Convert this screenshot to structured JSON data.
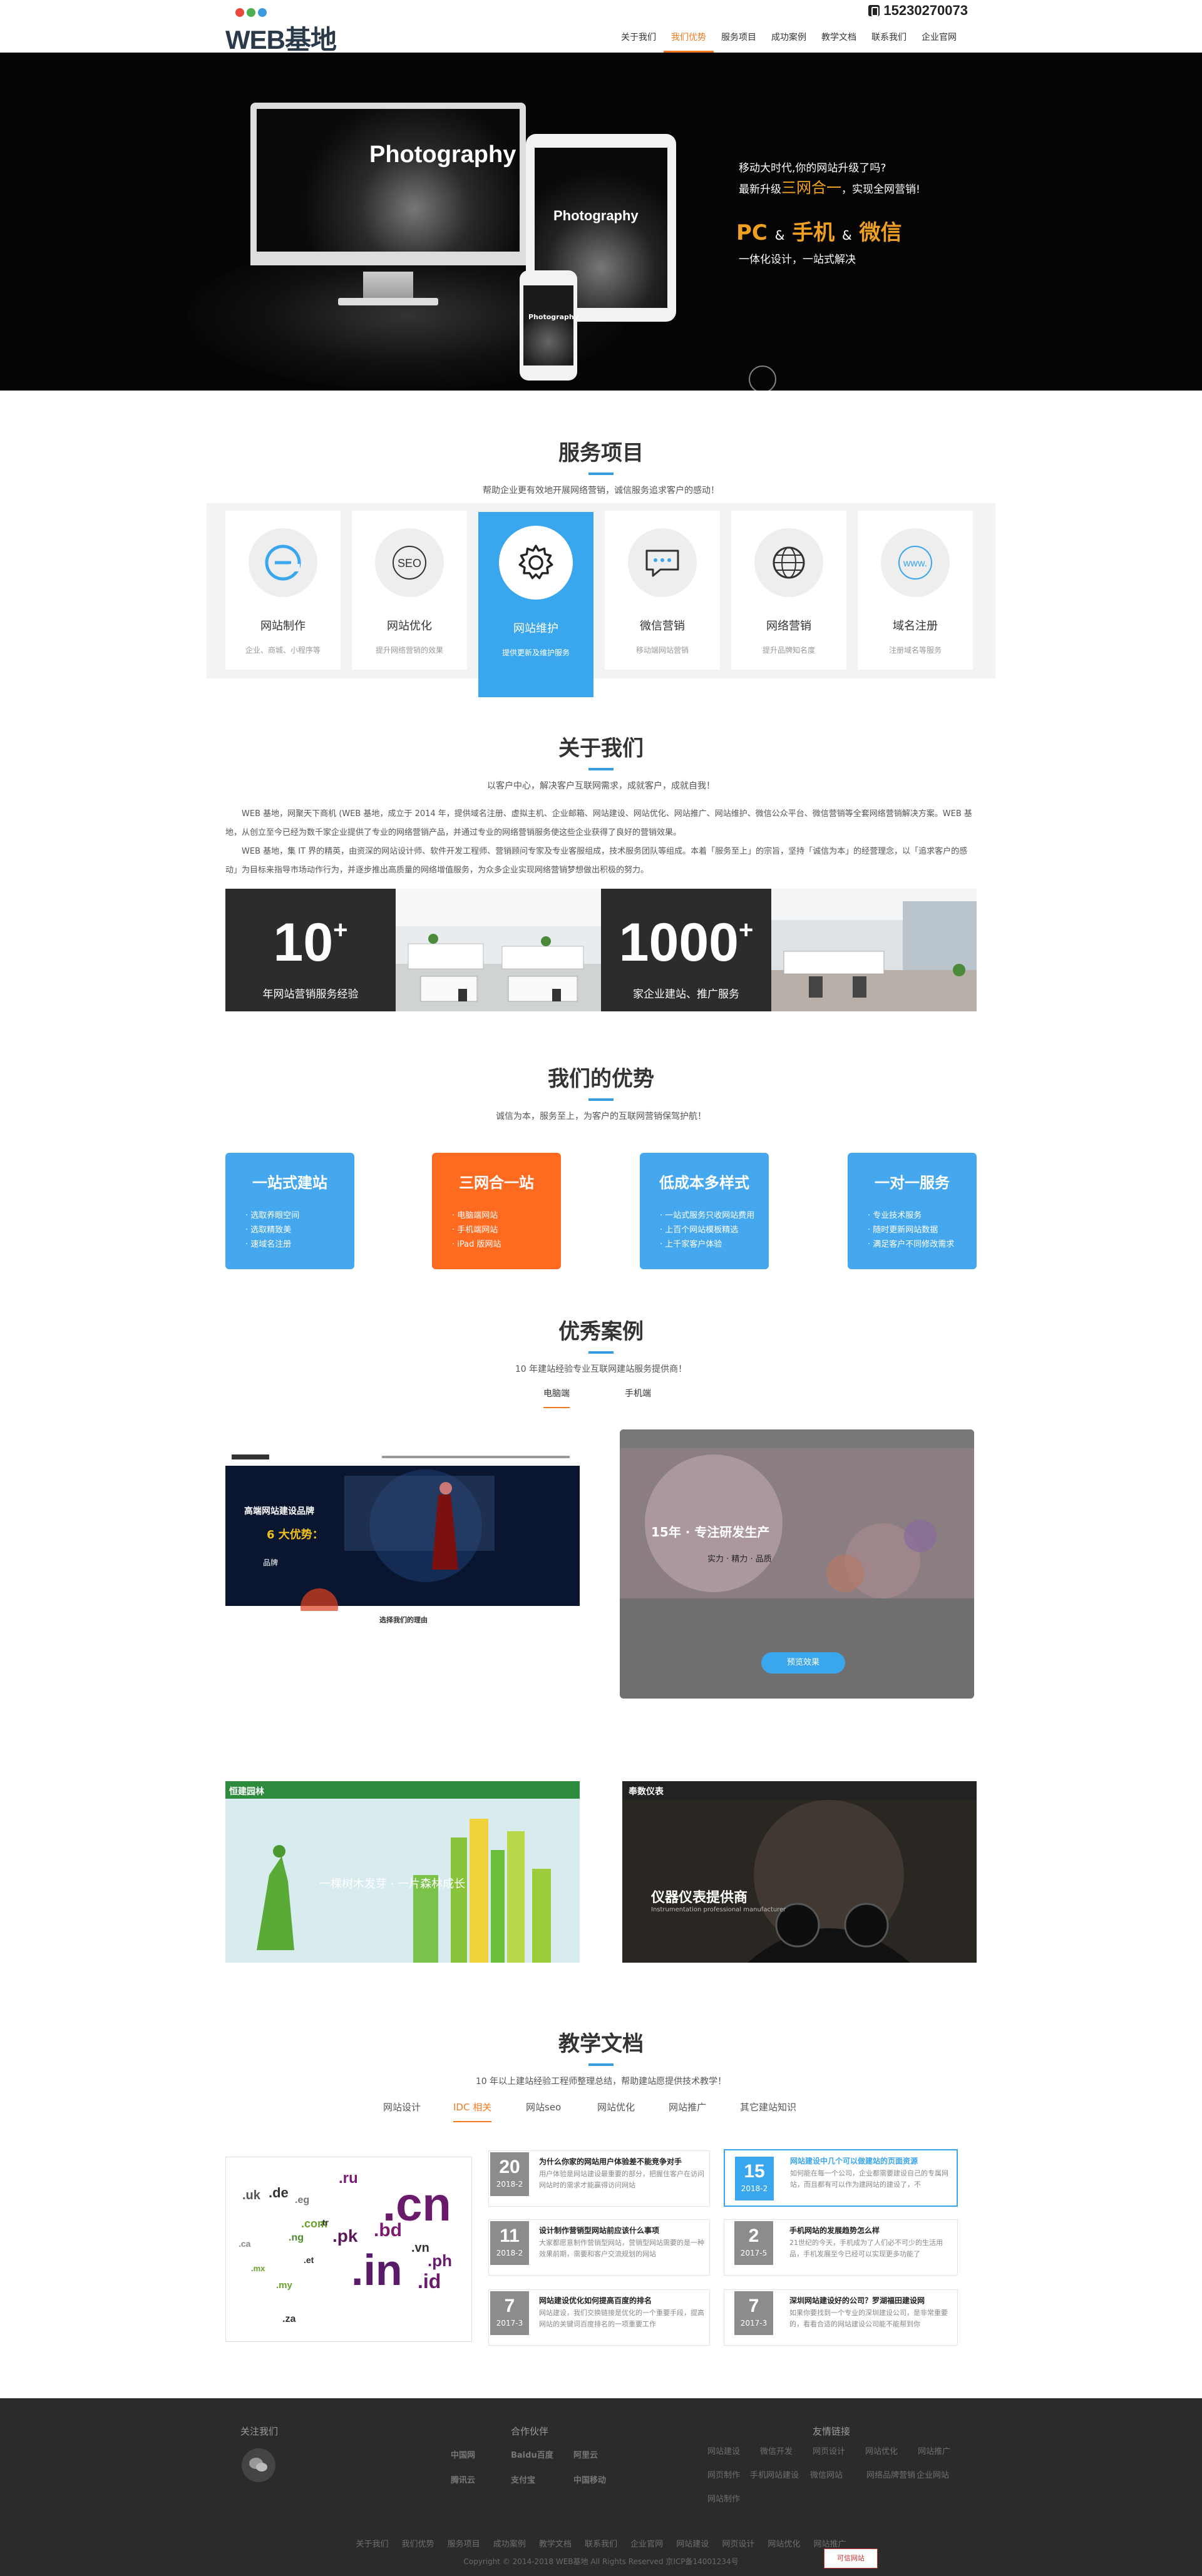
{
  "header": {
    "logo": "WEB基地",
    "phone": "15230270073",
    "nav": [
      "关于我们",
      "我们优势",
      "服务项目",
      "成功案例",
      "教学文档",
      "联系我们",
      "企业官网"
    ],
    "nav_active_index": 1
  },
  "banner": {
    "mockup_title": "Photography",
    "line1": "移动大时代,你的网站升级了吗?",
    "line2_prefix": "最新升级",
    "line2_highlight": "三网合一",
    "line2_suffix": "，实现全网营销!",
    "platforms": "PC & 手机 & 微信",
    "pc": "PC",
    "amp": "&",
    "mobile": "手机",
    "wechat": "微信",
    "tagline": "一体化设计，一站式解决"
  },
  "services": {
    "title": "服务项目",
    "subtitle": "帮助企业更有效地开展网络营销，诚信服务追求客户的感动！",
    "items": [
      {
        "name": "网站制作",
        "desc": "企业、商城、小程序等",
        "icon": "e-icon"
      },
      {
        "name": "网站优化",
        "desc": "提升网络营销的效果",
        "icon": "seo-icon"
      },
      {
        "name": "网站维护",
        "desc": "提供更新及维护服务",
        "icon": "gear-icon"
      },
      {
        "name": "微信营销",
        "desc": "移动端网站营销",
        "icon": "chat-bubble-icon"
      },
      {
        "name": "网络营销",
        "desc": "提升品牌知名度",
        "icon": "globe-icon"
      },
      {
        "name": "域名注册",
        "desc": "注册域名等服务",
        "icon": "www-icon"
      }
    ],
    "active_index": 2
  },
  "about": {
    "title": "关于我们",
    "subtitle": "以客户中心，解决客户互联网需求，成就客户，成就自我！",
    "p1": "WEB 基地，网聚天下商机 (WEB 基地，成立于 2014 年，提供域名注册、虚拟主机、企业邮箱、网站建设、网站优化、网站推广、网站维护、微信公众平台、微信营销等全套网络营销解决方案。WEB 基地，从创立至今已经为数千家企业提供了专业的网络营销产品，并通过专业的网络营销服务使这些企业获得了良好的营销效果。",
    "p2": "WEB 基地，集 IT 界的精英，由资深的网站设计师、软件开发工程师、营销顾问专家及专业客服组成，技术服务团队等组成。本着「服务至上」的宗旨，坚持「诚信为本」的经营理念，以「追求客户的感动」为目标来指导市场动作行为，并逐步推出高质量的网络增值服务，为众多企业实现网络营销梦想做出积极的努力。",
    "stats": [
      {
        "num": "10",
        "sup": "+",
        "label": "年网站营销服务经验"
      },
      {
        "num": "1000",
        "sup": "+",
        "label": "家企业建站、推广服务"
      }
    ]
  },
  "advantages": {
    "title": "我们的优势",
    "subtitle": "诚信为本，服务至上，为客户的互联网营销保驾护航！",
    "items": [
      {
        "title": "一站式建站",
        "points": [
          "选取养眼空间",
          "选取精致美",
          "速域名注册"
        ],
        "color": "#45a8ef"
      },
      {
        "title": "三网合一站",
        "points": [
          "电脑端网站",
          "手机端网站",
          "iPad 版网站"
        ],
        "color": "#ff6a21"
      },
      {
        "title": "低成本多样式",
        "points": [
          "一站式服务只收网站费用",
          "上百个网站模板精选",
          "上千家客户体验"
        ],
        "color": "#45a8ef"
      },
      {
        "title": "一对一服务",
        "points": [
          "专业技术服务",
          "随时更新网站数据",
          "满足客户不同修改需求"
        ],
        "color": "#45a8ef"
      }
    ]
  },
  "cases": {
    "title": "优秀案例",
    "subtitle": "10 年建站经验专业互联网建站服务提供商！",
    "tabs": [
      "电脑端",
      "手机端"
    ],
    "active_tab": 0,
    "items": [
      {
        "headline": "高端网站建设品牌",
        "sub": "6 大优势：",
        "tags": "品牌",
        "footer": "选择我们的理由"
      },
      {
        "headline": "15年 · 专注研发生产",
        "sub": "实力 · 精力 · 品质",
        "button": "预览效果"
      },
      {
        "headline": "一棵树木发芽 · 一片森林成长",
        "brand": "恒建园林"
      },
      {
        "headline": "仪器仪表提供商",
        "brand": "奉数仪表",
        "sub": "Instrumentation professional manufacturer"
      }
    ]
  },
  "docs": {
    "title": "教学文档",
    "subtitle": "10 年以上建站经验工程师整理总结，帮助建站愿提供技术教学！",
    "tabs": [
      "网站设计",
      "IDC 相关",
      "网站seo",
      "网站优化",
      "网站推广",
      "其它建站知识"
    ],
    "active_tab": 1,
    "tags": [
      ".ru",
      ".uk",
      ".de",
      ".cn",
      ".eg",
      ".pk",
      ".bd",
      ".com",
      ".in",
      ".vn",
      ".ph",
      ".id",
      ".ng",
      ".tr",
      ".ca",
      ".za",
      ".mx",
      ".et",
      ".my"
    ],
    "news": [
      {
        "day": "20",
        "ym": "2018-2",
        "title": "为什么你家的网站用户体验差不能竞争对手",
        "excerpt": "用户体验是网站建设最重要的部分，把握住客户在访问网站时的需求才能赢得访问网站"
      },
      {
        "day": "15",
        "ym": "2018-2",
        "title": "网站建设中几个可以做建站的页面资源",
        "excerpt": "如何能在每一个公司，企业都需要建设自己的专属网站，而且都有可以作为建网站的建设了，不"
      },
      {
        "day": "11",
        "ym": "2018-2",
        "title": "设计制作营销型网站前应该什么事项",
        "excerpt": "大家都愿意制作营销型网站，营销型网站需要的是一种效果前期，需要和客户交流规划的网站"
      },
      {
        "day": "2",
        "ym": "2017-5",
        "title": "手机网站的发展趋势怎么样",
        "excerpt": "21世纪的今天，手机成为了人们必不可少的生活用品，手机发展至今已经可以实现更多功能了"
      },
      {
        "day": "7",
        "ym": "2017-3",
        "title": "网站建设优化如何提高百度的排名",
        "excerpt": "网站建设，我们交换链接是优化的一个重要手段，提高网站的关键词百度排名的一项重要工作"
      },
      {
        "day": "7",
        "ym": "2017-3",
        "title": "深圳网站建设好的公司？罗湖福田建设网",
        "excerpt": "如果你要找到一个专业的深圳建设公司，是非常重要的，看看合适的网站建设公司能不能帮到你"
      }
    ]
  },
  "footer": {
    "follow_title": "关注我们",
    "partners_title": "合作伙伴",
    "links_title": "友情链接",
    "partners": [
      "中国网",
      "Baidu百度",
      "阿里云",
      "腾讯云",
      "支付宝",
      "中国移动"
    ],
    "links": [
      "网站建设",
      "微信开发",
      "网页设计",
      "网站优化",
      "网站推广",
      "网页制作",
      "手机网站建设",
      "微信网站",
      "网络品牌营销",
      "企业网站",
      "网站制作"
    ],
    "bottom_nav": [
      "关于我们",
      "我们优势",
      "服务项目",
      "成功案例",
      "教学文档",
      "联系我们",
      "企业官网",
      "网站建设",
      "网页设计",
      "网站优化",
      "网站推广"
    ],
    "copyright": "Copyright © 2014-2018 WEB基地 All Rights Reserved   京ICP备14001234号",
    "badge": "可信网站"
  }
}
